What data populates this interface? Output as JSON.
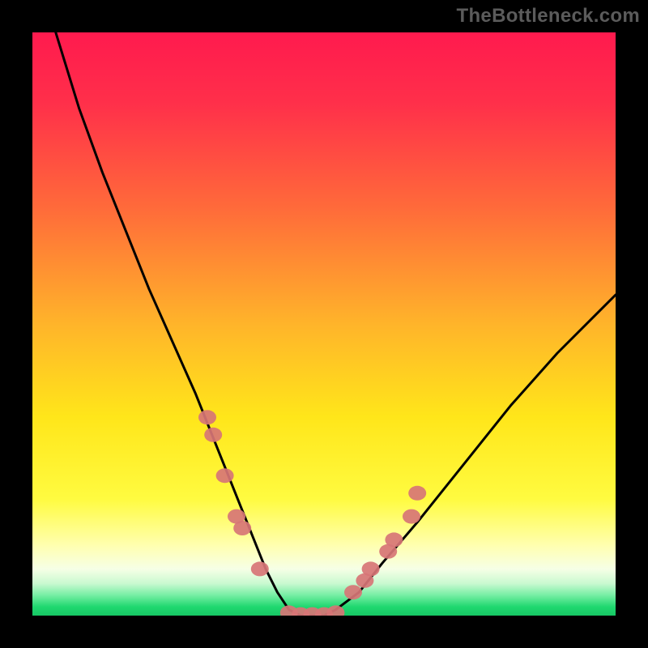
{
  "watermark": "TheBottleneck.com",
  "chart_data": {
    "type": "line",
    "title": "",
    "xlabel": "",
    "ylabel": "",
    "xlim": [
      0,
      100
    ],
    "ylim": [
      0,
      100
    ],
    "grid": false,
    "series": [
      {
        "name": "curve",
        "color": "#000000",
        "x": [
          4,
          8,
          12,
          16,
          20,
          24,
          28,
          30,
          32,
          34,
          36,
          38,
          40,
          42,
          44,
          46,
          48,
          50,
          52,
          56,
          60,
          66,
          74,
          82,
          90,
          100
        ],
        "y": [
          100,
          87,
          76,
          66,
          56,
          47,
          38,
          33,
          28,
          23,
          18,
          13,
          8,
          4,
          1,
          0,
          0,
          0,
          1,
          4,
          9,
          16,
          26,
          36,
          45,
          55
        ]
      },
      {
        "name": "left-dots",
        "color": "#d77576",
        "type": "scatter",
        "x": [
          30,
          31,
          33,
          35,
          36,
          39
        ],
        "y": [
          34,
          31,
          24,
          17,
          15,
          8
        ]
      },
      {
        "name": "right-dots",
        "color": "#d77576",
        "type": "scatter",
        "x": [
          55,
          57,
          58,
          61,
          62,
          65,
          66
        ],
        "y": [
          4,
          6,
          8,
          11,
          13,
          17,
          21
        ]
      },
      {
        "name": "bottom-dots",
        "color": "#d77576",
        "type": "scatter",
        "x": [
          44,
          46,
          48,
          50,
          52
        ],
        "y": [
          0.5,
          0.2,
          0.2,
          0.2,
          0.5
        ]
      }
    ],
    "background_gradient": {
      "stops": [
        {
          "offset": 0.0,
          "color": "#ff1a4e"
        },
        {
          "offset": 0.12,
          "color": "#ff2f4a"
        },
        {
          "offset": 0.3,
          "color": "#ff6a3a"
        },
        {
          "offset": 0.5,
          "color": "#ffb42a"
        },
        {
          "offset": 0.66,
          "color": "#ffe61a"
        },
        {
          "offset": 0.8,
          "color": "#fffb40"
        },
        {
          "offset": 0.88,
          "color": "#ffffb0"
        },
        {
          "offset": 0.92,
          "color": "#f6ffe6"
        },
        {
          "offset": 0.945,
          "color": "#c9f9d0"
        },
        {
          "offset": 0.965,
          "color": "#76eea4"
        },
        {
          "offset": 0.985,
          "color": "#1fd86f"
        },
        {
          "offset": 1.0,
          "color": "#17c765"
        }
      ]
    },
    "green_band": {
      "from_y": 0,
      "to_y": 6
    }
  }
}
